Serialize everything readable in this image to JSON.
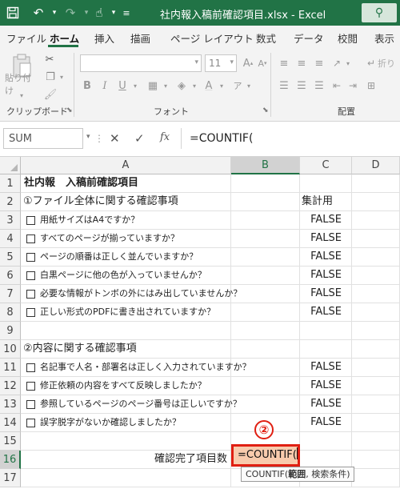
{
  "window": {
    "title": "社内報入稿前確認項目.xlsx  -  Excel",
    "icons": [
      "save-icon",
      "undo-icon",
      "redo-icon",
      "touch-mode-icon",
      "customize-toolbar-icon",
      "search-icon"
    ]
  },
  "tabs": [
    {
      "label": "ファイル"
    },
    {
      "label": "ホーム",
      "active": true
    },
    {
      "label": "挿入"
    },
    {
      "label": "描画"
    },
    {
      "label": "ページ レイアウト"
    },
    {
      "label": "数式"
    },
    {
      "label": "データ"
    },
    {
      "label": "校閲"
    },
    {
      "label": "表示"
    }
  ],
  "ribbon": {
    "paste_label": "貼り付け",
    "clipboard_label": "クリップボード",
    "font_label": "フォント",
    "font_size": "11",
    "alignment_label": "配置",
    "wrap_label": "折り"
  },
  "formula_bar": {
    "name_box": "SUM",
    "cancel_glyph": "✕",
    "enter_glyph": "✓",
    "fx_glyph": "fx",
    "formula": "=COUNTIF("
  },
  "columns": [
    "A",
    "B",
    "C",
    "D"
  ],
  "rows": [
    {
      "num": "1",
      "a": "社内報　入稿前確認項目",
      "style": "bold"
    },
    {
      "num": "2",
      "a": "①ファイル全体に関する確認事項",
      "style": "h",
      "c": "集計用"
    },
    {
      "num": "3",
      "a": "用紙サイズはA4ですか？",
      "check": true,
      "c": "FALSE"
    },
    {
      "num": "4",
      "a": "すべてのページが揃っていますか？",
      "check": true,
      "c": "FALSE"
    },
    {
      "num": "5",
      "a": "ページの順番は正しく並んでいますか？",
      "check": true,
      "c": "FALSE"
    },
    {
      "num": "6",
      "a": "白黒ページに他の色が入っていませんか？",
      "check": true,
      "c": "FALSE"
    },
    {
      "num": "7",
      "a": "必要な情報がトンボの外にはみ出していませんか？",
      "check": true,
      "c": "FALSE"
    },
    {
      "num": "8",
      "a": "正しい形式のPDFに書き出されていますか？",
      "check": true,
      "c": "FALSE"
    },
    {
      "num": "9"
    },
    {
      "num": "10",
      "a": "②内容に関する確認事項",
      "style": "h"
    },
    {
      "num": "11",
      "a": "名記事で人名・部署名は正しく入力されていますか？",
      "check": true,
      "c": "FALSE"
    },
    {
      "num": "12",
      "a": "修正依頼の内容をすべて反映しましたか？",
      "check": true,
      "c": "FALSE"
    },
    {
      "num": "13",
      "a": "参照しているページのページ番号は正しいですか？",
      "check": true,
      "c": "FALSE"
    },
    {
      "num": "14",
      "a": "誤字脱字がないか確認しましたか？",
      "check": true,
      "c": "FALSE"
    },
    {
      "num": "15"
    },
    {
      "num": "16",
      "a": "確認完了項目数",
      "style": "right"
    },
    {
      "num": "17"
    }
  ],
  "active_cell": {
    "ref": "B16",
    "value": "=COUNTIF("
  },
  "tooltip": {
    "fn": "COUNTIF(",
    "arg1": "範囲",
    "rest": ", 検索条件)"
  },
  "step_badge": "②",
  "colors": {
    "excel_green": "#217346",
    "highlight": "#f8cbad",
    "annotation_red": "#e01f12"
  }
}
